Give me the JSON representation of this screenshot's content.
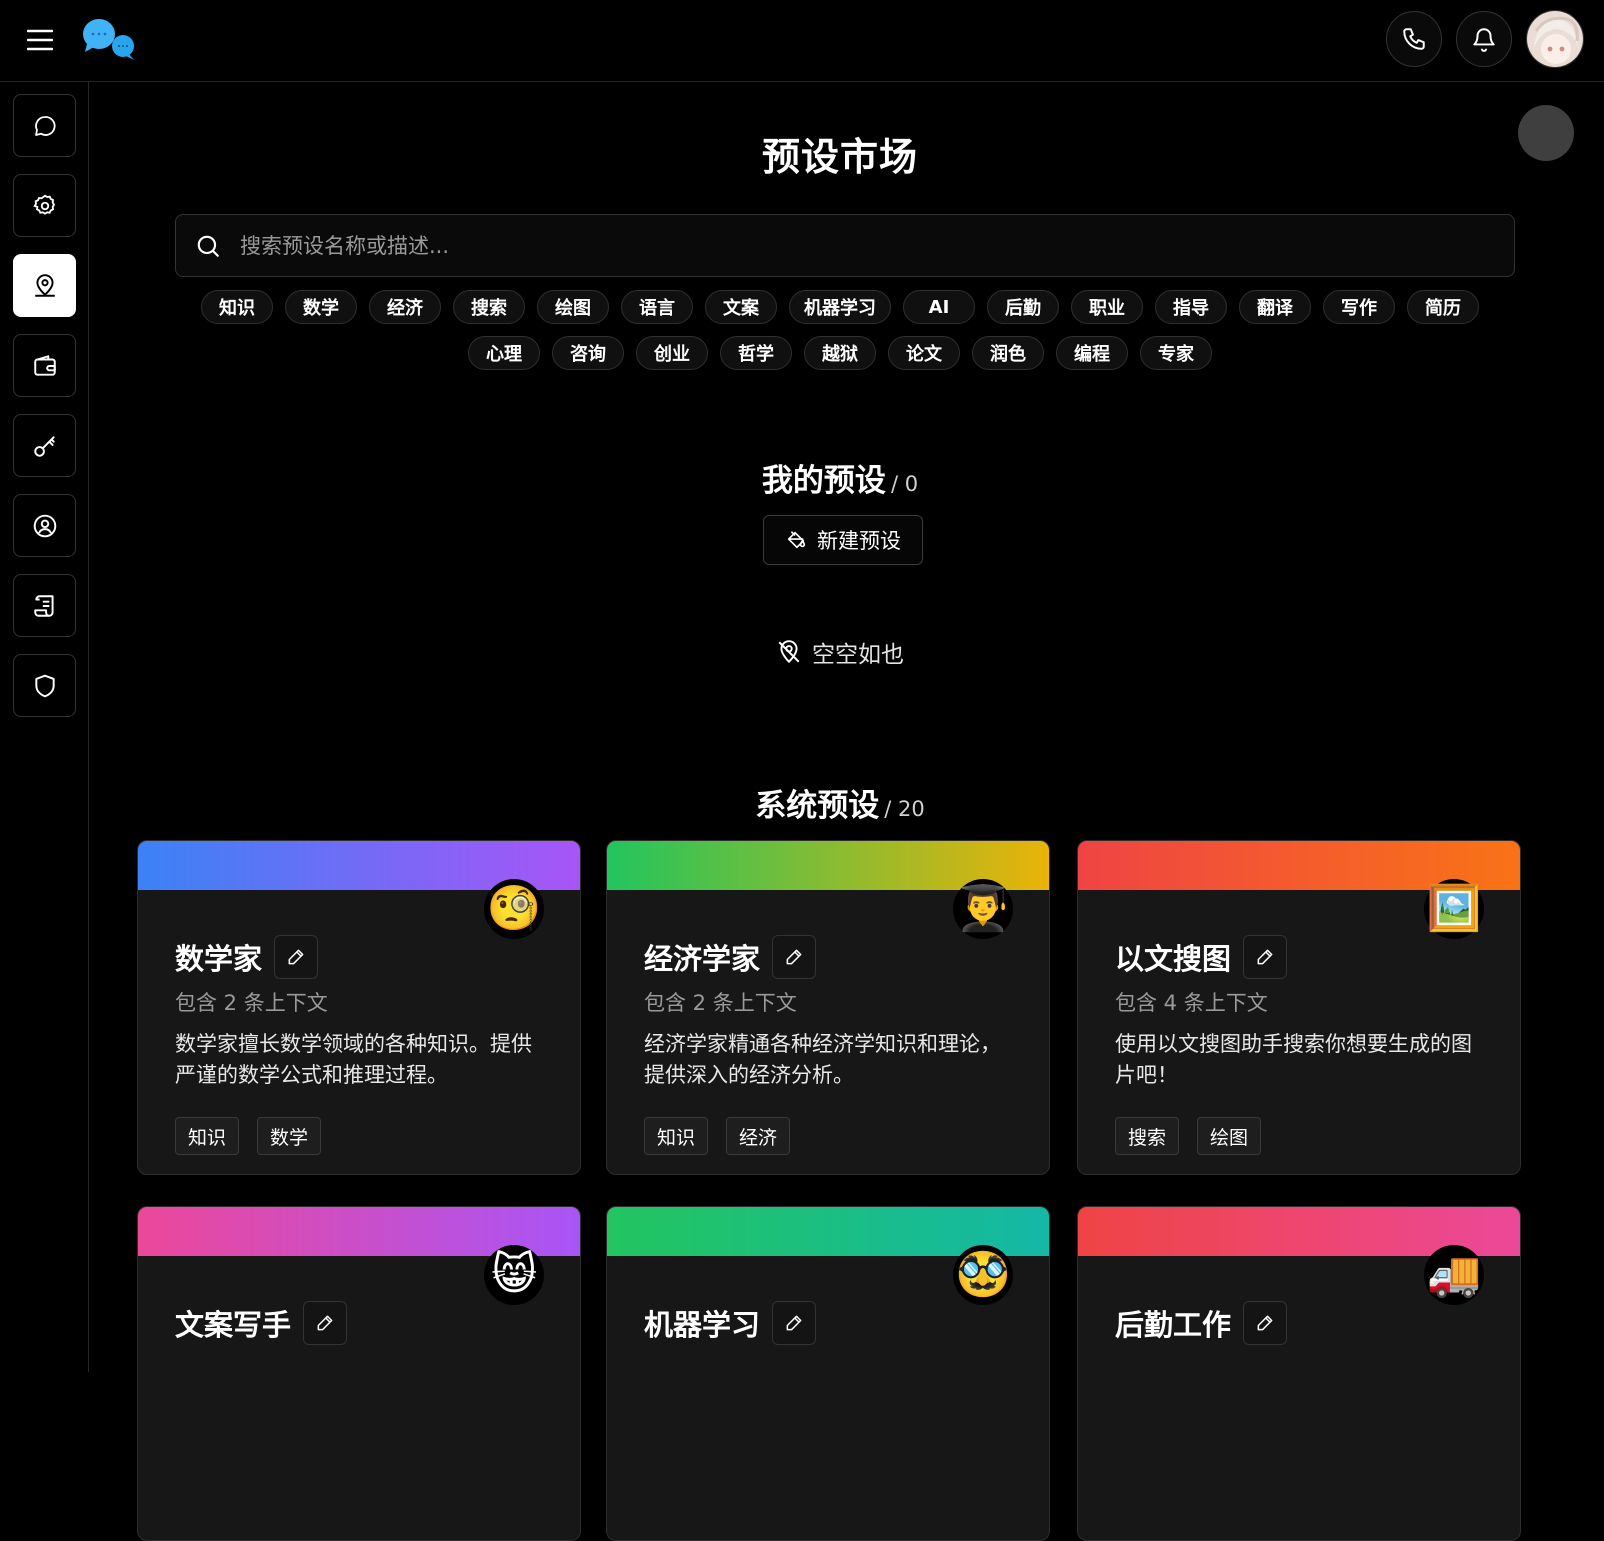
{
  "header": {
    "menu_icon": "hamburger-icon",
    "logo_icon": "chat-bubbles-logo",
    "phone_icon": "phone-icon",
    "bell_icon": "bell-icon",
    "avatar_icon": "user-avatar"
  },
  "sidebar": {
    "items": [
      {
        "name": "chat",
        "icon": "chat-bubble-icon",
        "active": false
      },
      {
        "name": "settings",
        "icon": "gear-icon",
        "active": false
      },
      {
        "name": "presets",
        "icon": "map-pin-user-icon",
        "active": true
      },
      {
        "name": "wallet",
        "icon": "wallet-icon",
        "active": false
      },
      {
        "name": "api-keys",
        "icon": "key-icon",
        "active": false
      },
      {
        "name": "profile",
        "icon": "user-circle-icon",
        "active": false
      },
      {
        "name": "logs",
        "icon": "scroll-icon",
        "active": false
      },
      {
        "name": "security",
        "icon": "shield-icon",
        "active": false
      }
    ]
  },
  "page": {
    "title": "预设市场",
    "search_placeholder": "搜索预设名称或描述..."
  },
  "tags": {
    "row1": [
      "知识",
      "数学",
      "经济",
      "搜索",
      "绘图",
      "语言",
      "文案",
      "机器学习",
      "AI",
      "后勤",
      "职业",
      "指导",
      "翻译",
      "写作",
      "简历"
    ],
    "row2": [
      "心理",
      "咨询",
      "创业",
      "哲学",
      "越狱",
      "论文",
      "润色",
      "编程",
      "专家"
    ]
  },
  "my_presets": {
    "title": "我的预设",
    "count": "/ 0",
    "new_button": "新建预设",
    "empty_text": "空空如也"
  },
  "system_presets": {
    "title": "系统预设",
    "count": "/ 20",
    "cards": [
      {
        "title": "数学家",
        "emoji": "🧐",
        "subtitle": "包含 2 条上下文",
        "description": "数学家擅长数学领域的各种知识。提供严谨的数学公式和推理过程。",
        "tags": [
          "知识",
          "数学"
        ],
        "gradient": [
          "#3b82f6",
          "#a855f7"
        ]
      },
      {
        "title": "经济学家",
        "emoji": "👨‍🎓",
        "subtitle": "包含 2 条上下文",
        "description": "经济学家精通各种经济学知识和理论，提供深入的经济分析。",
        "tags": [
          "知识",
          "经济"
        ],
        "gradient": [
          "#22c55e",
          "#eab308"
        ]
      },
      {
        "title": "以文搜图",
        "emoji": "🖼️",
        "subtitle": "包含 4 条上下文",
        "description": "使用以文搜图助手搜索你想要生成的图片吧！",
        "tags": [
          "搜索",
          "绘图"
        ],
        "gradient": [
          "#ef4444",
          "#f97316"
        ]
      },
      {
        "title": "文案写手",
        "emoji": "😸",
        "gradient": [
          "#ec4899",
          "#a855f7"
        ]
      },
      {
        "title": "机器学习",
        "emoji": "🥸",
        "gradient": [
          "#22c55e",
          "#14b8a6"
        ]
      },
      {
        "title": "后勤工作",
        "emoji": "🚚",
        "gradient": [
          "#ef4444",
          "#ec4899"
        ]
      }
    ]
  }
}
